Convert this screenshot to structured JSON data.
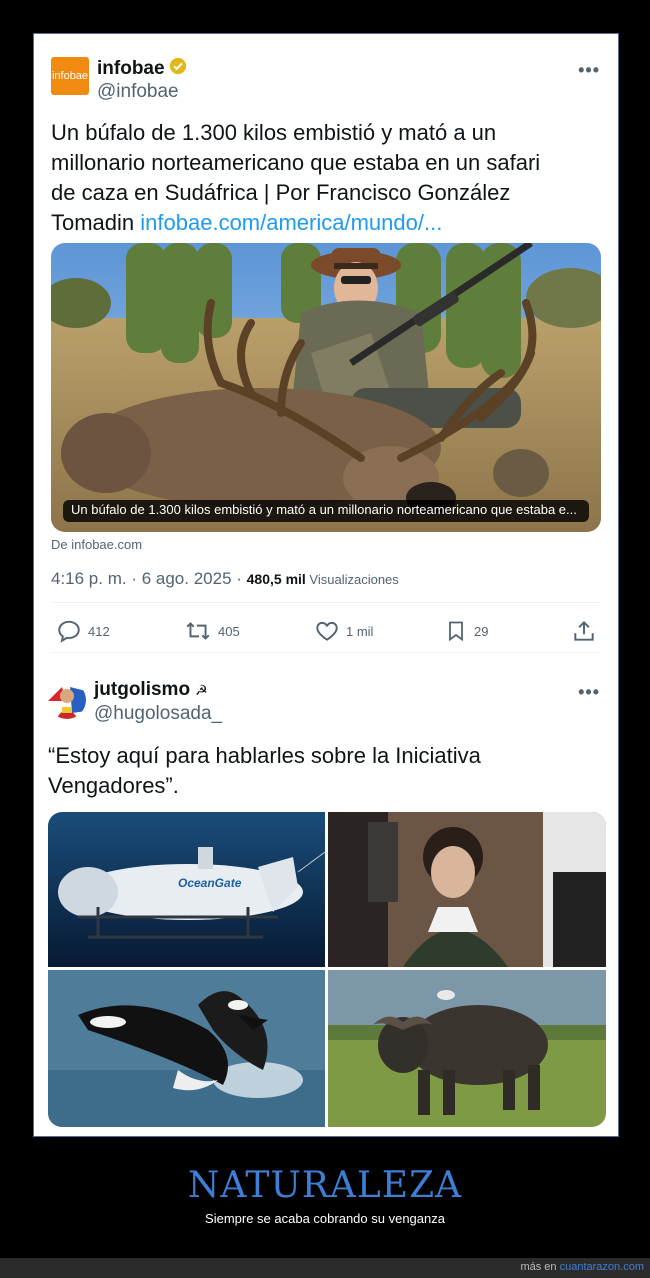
{
  "tweet1": {
    "avatar_text": "infobae",
    "name": "infobae",
    "handle": "@infobae",
    "more": "•••",
    "text_line1": "Un búfalo de 1.300 kilos embistió y mató a un",
    "text_line2": "millonario norteamericano que estaba en un safari",
    "text_line3": "de caza en Sudáfrica | Por Francisco González",
    "text_line4a": "Tomadin ",
    "link": "infobae.com/america/mundo/...",
    "image_caption": "Un búfalo de 1.300 kilos embistió y mató a un millonario norteamericano que estaba e...",
    "source": "De infobae.com",
    "time": "4:16 p. m.",
    "sep1": " · ",
    "date": "6 ago. 2025",
    "sep2": " · ",
    "views_count": "480,5 mil",
    "views_label": " Visualizaciones",
    "replies": "412",
    "retweets": "405",
    "likes": "1 mil",
    "bookmarks": "29"
  },
  "tweet2": {
    "name": "jutgolismo",
    "name_symbol": "☭",
    "handle": "@hugolosada_",
    "more": "•••",
    "text_line1": "“Estoy aquí para hablarles sobre la Iniciativa",
    "text_line2": "Vengadores”.",
    "submarine_brand": "OceanGate"
  },
  "caption": {
    "title": "NATURALEZA",
    "subtitle": "Siempre se acaba cobrando su venganza"
  },
  "footer": {
    "prefix": "más en ",
    "site": "cuantarazon.com"
  },
  "colors": {
    "link": "#1d9bf0",
    "infobae_orange": "#f08a10",
    "caption_title": "#3d7fd4",
    "verified_gold": "#e2b719"
  }
}
